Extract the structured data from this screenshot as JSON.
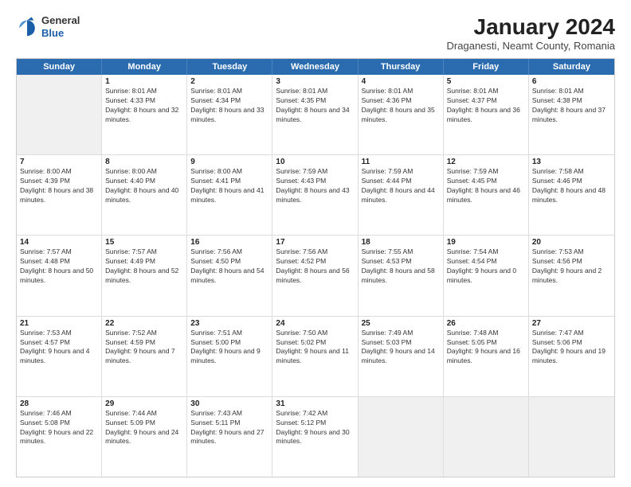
{
  "header": {
    "logo": {
      "general": "General",
      "blue": "Blue"
    },
    "title": "January 2024",
    "subtitle": "Draganesti, Neamt County, Romania"
  },
  "weekdays": [
    "Sunday",
    "Monday",
    "Tuesday",
    "Wednesday",
    "Thursday",
    "Friday",
    "Saturday"
  ],
  "weeks": [
    [
      {
        "day": "",
        "sunrise": "",
        "sunset": "",
        "daylight": "",
        "empty": true
      },
      {
        "day": "1",
        "sunrise": "Sunrise: 8:01 AM",
        "sunset": "Sunset: 4:33 PM",
        "daylight": "Daylight: 8 hours and 32 minutes."
      },
      {
        "day": "2",
        "sunrise": "Sunrise: 8:01 AM",
        "sunset": "Sunset: 4:34 PM",
        "daylight": "Daylight: 8 hours and 33 minutes."
      },
      {
        "day": "3",
        "sunrise": "Sunrise: 8:01 AM",
        "sunset": "Sunset: 4:35 PM",
        "daylight": "Daylight: 8 hours and 34 minutes."
      },
      {
        "day": "4",
        "sunrise": "Sunrise: 8:01 AM",
        "sunset": "Sunset: 4:36 PM",
        "daylight": "Daylight: 8 hours and 35 minutes."
      },
      {
        "day": "5",
        "sunrise": "Sunrise: 8:01 AM",
        "sunset": "Sunset: 4:37 PM",
        "daylight": "Daylight: 8 hours and 36 minutes."
      },
      {
        "day": "6",
        "sunrise": "Sunrise: 8:01 AM",
        "sunset": "Sunset: 4:38 PM",
        "daylight": "Daylight: 8 hours and 37 minutes."
      }
    ],
    [
      {
        "day": "7",
        "sunrise": "Sunrise: 8:00 AM",
        "sunset": "Sunset: 4:39 PM",
        "daylight": "Daylight: 8 hours and 38 minutes."
      },
      {
        "day": "8",
        "sunrise": "Sunrise: 8:00 AM",
        "sunset": "Sunset: 4:40 PM",
        "daylight": "Daylight: 8 hours and 40 minutes."
      },
      {
        "day": "9",
        "sunrise": "Sunrise: 8:00 AM",
        "sunset": "Sunset: 4:41 PM",
        "daylight": "Daylight: 8 hours and 41 minutes."
      },
      {
        "day": "10",
        "sunrise": "Sunrise: 7:59 AM",
        "sunset": "Sunset: 4:43 PM",
        "daylight": "Daylight: 8 hours and 43 minutes."
      },
      {
        "day": "11",
        "sunrise": "Sunrise: 7:59 AM",
        "sunset": "Sunset: 4:44 PM",
        "daylight": "Daylight: 8 hours and 44 minutes."
      },
      {
        "day": "12",
        "sunrise": "Sunrise: 7:59 AM",
        "sunset": "Sunset: 4:45 PM",
        "daylight": "Daylight: 8 hours and 46 minutes."
      },
      {
        "day": "13",
        "sunrise": "Sunrise: 7:58 AM",
        "sunset": "Sunset: 4:46 PM",
        "daylight": "Daylight: 8 hours and 48 minutes."
      }
    ],
    [
      {
        "day": "14",
        "sunrise": "Sunrise: 7:57 AM",
        "sunset": "Sunset: 4:48 PM",
        "daylight": "Daylight: 8 hours and 50 minutes."
      },
      {
        "day": "15",
        "sunrise": "Sunrise: 7:57 AM",
        "sunset": "Sunset: 4:49 PM",
        "daylight": "Daylight: 8 hours and 52 minutes."
      },
      {
        "day": "16",
        "sunrise": "Sunrise: 7:56 AM",
        "sunset": "Sunset: 4:50 PM",
        "daylight": "Daylight: 8 hours and 54 minutes."
      },
      {
        "day": "17",
        "sunrise": "Sunrise: 7:56 AM",
        "sunset": "Sunset: 4:52 PM",
        "daylight": "Daylight: 8 hours and 56 minutes."
      },
      {
        "day": "18",
        "sunrise": "Sunrise: 7:55 AM",
        "sunset": "Sunset: 4:53 PM",
        "daylight": "Daylight: 8 hours and 58 minutes."
      },
      {
        "day": "19",
        "sunrise": "Sunrise: 7:54 AM",
        "sunset": "Sunset: 4:54 PM",
        "daylight": "Daylight: 9 hours and 0 minutes."
      },
      {
        "day": "20",
        "sunrise": "Sunrise: 7:53 AM",
        "sunset": "Sunset: 4:56 PM",
        "daylight": "Daylight: 9 hours and 2 minutes."
      }
    ],
    [
      {
        "day": "21",
        "sunrise": "Sunrise: 7:53 AM",
        "sunset": "Sunset: 4:57 PM",
        "daylight": "Daylight: 9 hours and 4 minutes."
      },
      {
        "day": "22",
        "sunrise": "Sunrise: 7:52 AM",
        "sunset": "Sunset: 4:59 PM",
        "daylight": "Daylight: 9 hours and 7 minutes."
      },
      {
        "day": "23",
        "sunrise": "Sunrise: 7:51 AM",
        "sunset": "Sunset: 5:00 PM",
        "daylight": "Daylight: 9 hours and 9 minutes."
      },
      {
        "day": "24",
        "sunrise": "Sunrise: 7:50 AM",
        "sunset": "Sunset: 5:02 PM",
        "daylight": "Daylight: 9 hours and 11 minutes."
      },
      {
        "day": "25",
        "sunrise": "Sunrise: 7:49 AM",
        "sunset": "Sunset: 5:03 PM",
        "daylight": "Daylight: 9 hours and 14 minutes."
      },
      {
        "day": "26",
        "sunrise": "Sunrise: 7:48 AM",
        "sunset": "Sunset: 5:05 PM",
        "daylight": "Daylight: 9 hours and 16 minutes."
      },
      {
        "day": "27",
        "sunrise": "Sunrise: 7:47 AM",
        "sunset": "Sunset: 5:06 PM",
        "daylight": "Daylight: 9 hours and 19 minutes."
      }
    ],
    [
      {
        "day": "28",
        "sunrise": "Sunrise: 7:46 AM",
        "sunset": "Sunset: 5:08 PM",
        "daylight": "Daylight: 9 hours and 22 minutes."
      },
      {
        "day": "29",
        "sunrise": "Sunrise: 7:44 AM",
        "sunset": "Sunset: 5:09 PM",
        "daylight": "Daylight: 9 hours and 24 minutes."
      },
      {
        "day": "30",
        "sunrise": "Sunrise: 7:43 AM",
        "sunset": "Sunset: 5:11 PM",
        "daylight": "Daylight: 9 hours and 27 minutes."
      },
      {
        "day": "31",
        "sunrise": "Sunrise: 7:42 AM",
        "sunset": "Sunset: 5:12 PM",
        "daylight": "Daylight: 9 hours and 30 minutes."
      },
      {
        "day": "",
        "sunrise": "",
        "sunset": "",
        "daylight": "",
        "empty": true
      },
      {
        "day": "",
        "sunrise": "",
        "sunset": "",
        "daylight": "",
        "empty": true
      },
      {
        "day": "",
        "sunrise": "",
        "sunset": "",
        "daylight": "",
        "empty": true
      }
    ]
  ]
}
